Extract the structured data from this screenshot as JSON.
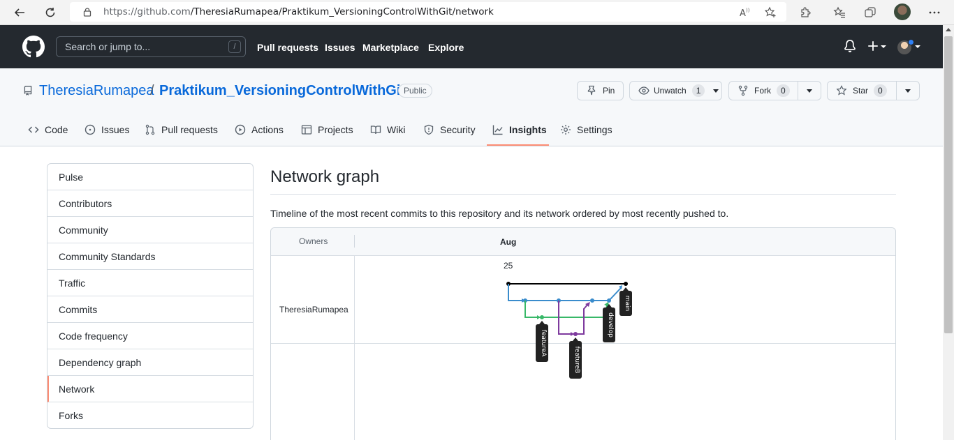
{
  "browser": {
    "url_prefix": "https://github.com",
    "url_path": "/TheresiaRumapea/Praktikum_VersioningControlWithGit/network"
  },
  "header": {
    "search_placeholder": "Search or jump to...",
    "search_shortcut": "/",
    "nav": [
      "Pull requests",
      "Issues",
      "Marketplace",
      "Explore"
    ]
  },
  "repo": {
    "owner": "TheresiaRumapea",
    "separator": "/",
    "name": "Praktikum_VersioningControlWithGit",
    "visibility": "Public",
    "pin_label": "Pin",
    "watch_label": "Unwatch",
    "watch_count": "1",
    "fork_label": "Fork",
    "fork_count": "0",
    "star_label": "Star",
    "star_count": "0"
  },
  "tabs": [
    {
      "label": "Code",
      "icon": "code-icon"
    },
    {
      "label": "Issues",
      "icon": "issue-icon"
    },
    {
      "label": "Pull requests",
      "icon": "pull-request-icon"
    },
    {
      "label": "Actions",
      "icon": "play-icon"
    },
    {
      "label": "Projects",
      "icon": "table-icon"
    },
    {
      "label": "Wiki",
      "icon": "book-icon"
    },
    {
      "label": "Security",
      "icon": "shield-icon"
    },
    {
      "label": "Insights",
      "icon": "graph-icon",
      "active": true
    },
    {
      "label": "Settings",
      "icon": "gear-icon"
    }
  ],
  "sidebar": {
    "items": [
      "Pulse",
      "Contributors",
      "Community",
      "Community Standards",
      "Traffic",
      "Commits",
      "Code frequency",
      "Dependency graph",
      "Network",
      "Forks"
    ],
    "active": "Network"
  },
  "main": {
    "title": "Network graph",
    "description": "Timeline of the most recent commits to this repository and its network ordered by most recently pushed to.",
    "owners_header": "Owners",
    "month": "Aug",
    "day": "25",
    "owner": "TheresiaRumapea",
    "branches": {
      "main": "main",
      "develop": "develop",
      "featureA": "featureA",
      "featureB": "featureB"
    }
  },
  "colors": {
    "accent_underline": "#fd8c73",
    "link": "#0969da",
    "branch_main": "#000000",
    "branch_develop": "#3a8ccc",
    "branch_featureA": "#38b868",
    "branch_featureB": "#7e3a9e"
  }
}
